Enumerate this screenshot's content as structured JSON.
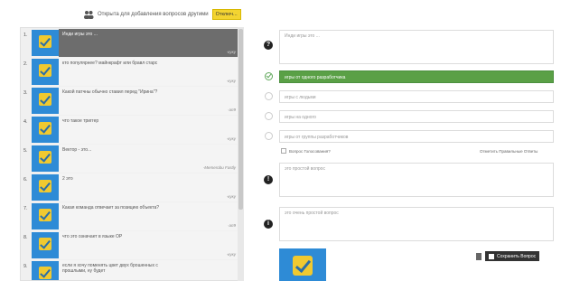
{
  "topbar": {
    "open_text": "Открыта для добавления вопросов другими",
    "toggle_label": "Отключ..."
  },
  "questions": [
    {
      "num": "1.",
      "text": "Инди игры это ...",
      "author": "-куку",
      "active": true
    },
    {
      "num": "2.",
      "text": "кто популярнее? майнкрафт или бравл старс",
      "author": "-куку",
      "active": false
    },
    {
      "num": "3.",
      "text": "Какой патчны обычно ставил перед \"Ирина\"?",
      "author": "-ап9",
      "active": false
    },
    {
      "num": "4.",
      "text": "что такое триггер",
      "author": "-куку",
      "active": false
    },
    {
      "num": "5.",
      "text": "Вектор - это...",
      "author": "-Memerobu Fastly",
      "active": false
    },
    {
      "num": "6.",
      "text": "2 это",
      "author": "-куку",
      "active": false
    },
    {
      "num": "7.",
      "text": "Какая команда отвечает за позицию объекта?",
      "author": "-ап9",
      "active": false
    },
    {
      "num": "8.",
      "text": "что это означает в языке ОР",
      "author": "-куку",
      "active": false
    },
    {
      "num": "9.",
      "text": "если я хочу поменять цвет двух брошенных с прошлыми, ну будет",
      "author": "",
      "active": false
    }
  ],
  "editor": {
    "question_placeholder": "Инди игры это ...",
    "answers": [
      {
        "text": "игры от одного разработчика",
        "correct": true
      },
      {
        "text": "игры с людьми",
        "correct": false
      },
      {
        "text": "игры на одного",
        "correct": false
      },
      {
        "text": "игры от группы разработчиков",
        "correct": false
      }
    ],
    "checkbox_label": "Вопрос Голосования?",
    "mark_link": "Отметить Правильные Ответы",
    "hint1": "это простой вопрос",
    "hint2": "это очень простой вопрос",
    "save_label": "Сохранить Вопрос"
  },
  "colors": {
    "accent_blue": "#2e8bd6",
    "correct_green": "#5aa046",
    "highlight_yellow": "#f3d431"
  }
}
